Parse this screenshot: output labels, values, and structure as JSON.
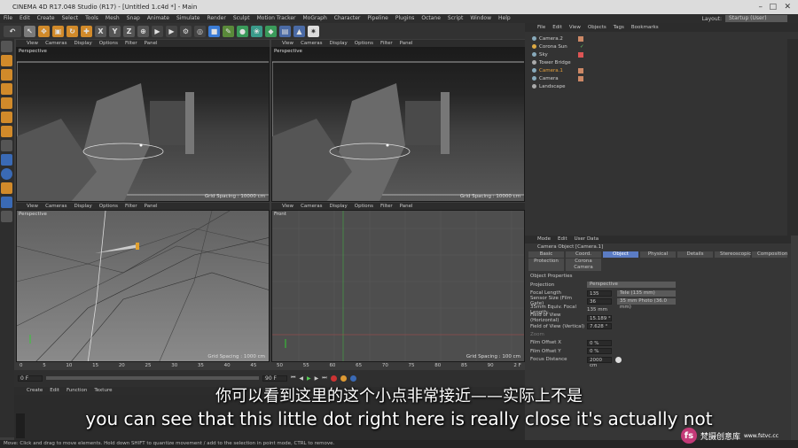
{
  "titlebar": {
    "title": "CINEMA 4D R17.048 Studio (R17) - [Untitled 1.c4d *] - Main"
  },
  "menubar": {
    "items": [
      "File",
      "Edit",
      "Create",
      "Select",
      "Tools",
      "Mesh",
      "Snap",
      "Animate",
      "Simulate",
      "Render",
      "Sculpt",
      "Motion Tracker",
      "MoGraph",
      "Character",
      "Pipeline",
      "Plugins",
      "Octane",
      "Script",
      "Window",
      "Help"
    ]
  },
  "layout": {
    "label": "Layout:",
    "value": "Startup (User)"
  },
  "toolbar": {
    "x": "X",
    "y": "Y",
    "z": "Z"
  },
  "viewport": {
    "menu": [
      "View",
      "Cameras",
      "Display",
      "Options",
      "Filter",
      "Panel"
    ],
    "vp1": {
      "label": "Perspective",
      "grid": "Grid Spacing : 10000 cm"
    },
    "vp2": {
      "label": "Perspective",
      "grid": "Grid Spacing : 10000 cm"
    },
    "vp3": {
      "label": "Perspective",
      "grid": "Grid Spacing : 1000 cm"
    },
    "vp4": {
      "label": "Front",
      "grid": "Grid Spacing : 100 cm"
    }
  },
  "objects": {
    "menu": [
      "File",
      "Edit",
      "View",
      "Objects",
      "Tags",
      "Bookmarks"
    ],
    "items": [
      {
        "name": "Camera.2",
        "color": "#8ab"
      },
      {
        "name": "Corona Sun",
        "color": "#da4"
      },
      {
        "name": "Sky",
        "color": "#8ab"
      },
      {
        "name": "Tower Bridge",
        "color": "#aaa"
      },
      {
        "name": "Camera.1",
        "color": "#8ab"
      },
      {
        "name": "Camera",
        "color": "#8ab"
      },
      {
        "name": "Landscape",
        "color": "#aaa"
      }
    ]
  },
  "attributes": {
    "menu": [
      "Mode",
      "Edit",
      "User Data"
    ],
    "header": "Camera Object [Camera.1]",
    "tabs": [
      "Basic",
      "Coord.",
      "Object",
      "Physical",
      "Details",
      "Stereoscopic",
      "Composition"
    ],
    "tabs2": [
      "Protection",
      "Corona Camera"
    ],
    "section": "Object Properties",
    "rows": [
      {
        "label": "Projection",
        "value": "Perspective"
      },
      {
        "label": "Focal Length",
        "value": "135",
        "extra": "Tele (135 mm)"
      },
      {
        "label": "Sensor Size (Film Gate)",
        "value": "36",
        "extra": "35 mm Photo (36.0 mm)"
      },
      {
        "label": "35mm Equiv. Focal Length:",
        "value": "135 mm"
      },
      {
        "label": "Field of View (Horizontal)",
        "value": "15.189 °"
      },
      {
        "label": "Field of View (Vertical)",
        "value": "7.628 °"
      },
      {
        "label": "Zoom",
        "value": ""
      },
      {
        "label": "Film Offset X",
        "value": "0 %"
      },
      {
        "label": "Film Offset Y",
        "value": "0 %"
      },
      {
        "label": "Focus Distance",
        "value": "2000 cm"
      }
    ]
  },
  "timeline": {
    "frames": [
      "0",
      "5",
      "10",
      "15",
      "20",
      "25",
      "30",
      "35",
      "40",
      "45",
      "50",
      "55",
      "60",
      "65",
      "70",
      "75",
      "80",
      "85",
      "90"
    ],
    "start": "0 F",
    "end": "90 F",
    "cur": "2 F"
  },
  "material": {
    "menu": [
      "Create",
      "Edit",
      "Function",
      "Texture"
    ]
  },
  "statusbar": "Move: Click and drag to move elements. Hold down SHIFT to quantize movement / add to the selection in point mode, CTRL to remove.",
  "subtitles": {
    "cn": "你可以看到这里的这个小点非常接近——实际上不是",
    "en": "you can see that this little dot right here is really close it's actually not"
  },
  "watermark": {
    "logo": "fs",
    "text": "梵摄创意库",
    "url": "www.fstvc.cc"
  }
}
